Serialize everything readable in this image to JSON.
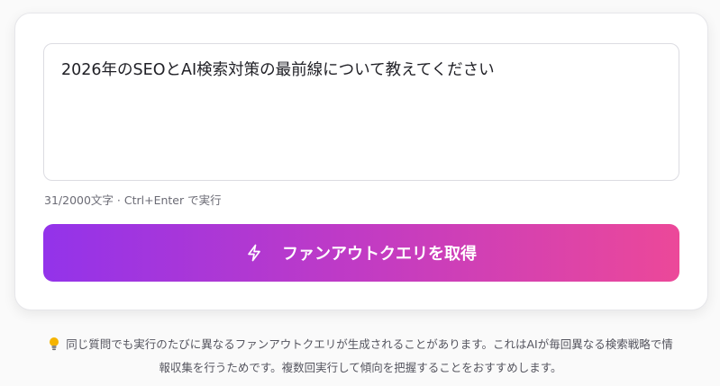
{
  "query": {
    "value": "2026年のSEOとAI検索対策の最前線について教えてください"
  },
  "counter": {
    "text": "31/2000文字 · Ctrl+Enter で実行"
  },
  "submit": {
    "icon": "lightning-icon",
    "label": "ファンアウトクエリを取得"
  },
  "note": {
    "icon": "lightbulb-icon",
    "line1": "同じ質問でも実行のたびに異なるファンアウトクエリが生成されることがあります。これはAIが毎回異なる検索戦略で情",
    "line2": "報収集を行うためです。複数回実行して傾向を把握することをおすすめします。"
  },
  "colors": {
    "gradient_start": "#9333ea",
    "gradient_end": "#ec4899",
    "bulb": "#f5b400"
  }
}
